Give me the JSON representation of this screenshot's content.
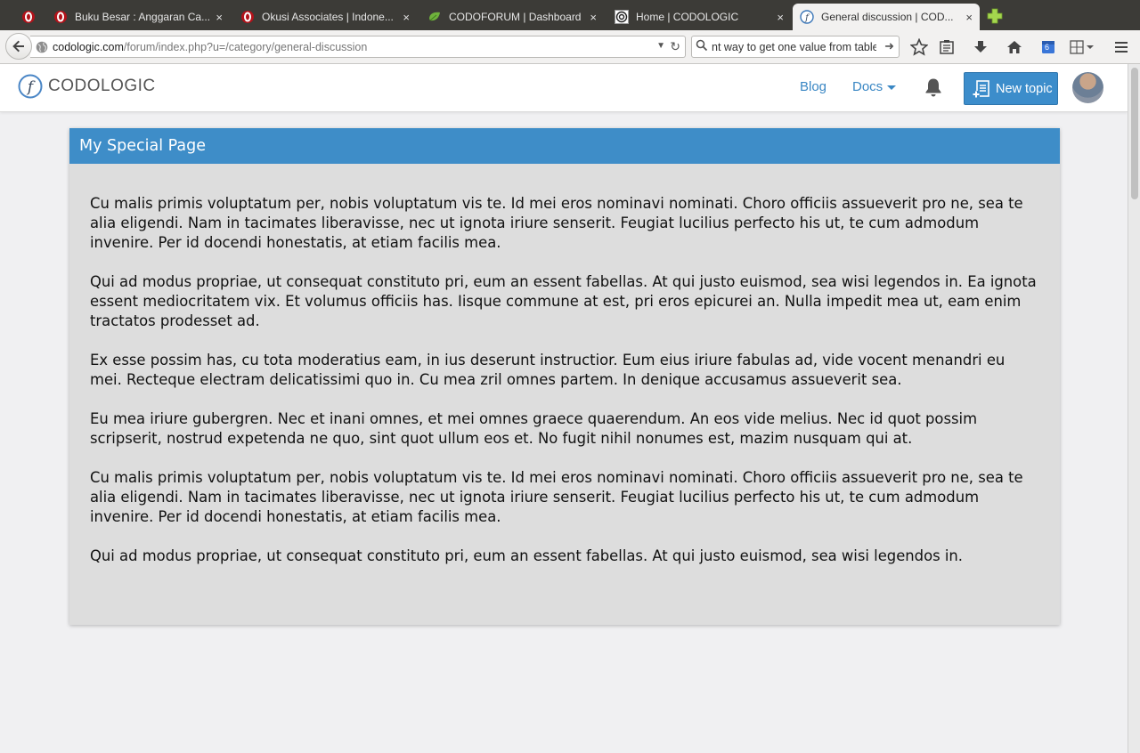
{
  "browser": {
    "tabs": [
      {
        "label": "",
        "pinned": true
      },
      {
        "label": "Buku Besar : Anggaran Ca..."
      },
      {
        "label": "Okusi Associates | Indone..."
      },
      {
        "label": "CODOFORUM | Dashboard"
      },
      {
        "label": "Home | CODOLOGIC"
      },
      {
        "label": "General discussion | COD...",
        "active": true
      }
    ],
    "close_glyph": "×",
    "url_host": "codologic.com",
    "url_path": "/forum/index.php?u=/category/general-discussion",
    "search_value": "nt way to get one value from table",
    "downloads_badge": "6",
    "colors": {
      "tabbar": "#3c3b37",
      "toolbar": "#f2f1f0"
    }
  },
  "site": {
    "logo_text": "CODOLOGIC",
    "nav": {
      "blog": "Blog",
      "docs": "Docs"
    },
    "new_topic_label": "New topic",
    "accent": "#3c8dcb"
  },
  "card": {
    "title": "My Special Page",
    "paragraphs": [
      "Cu malis primis voluptatum per, nobis voluptatum vis te. Id mei eros nominavi nominati. Choro officiis assueverit pro ne, sea te alia eligendi. Nam in tacimates liberavisse, nec ut ignota iriure senserit. Feugiat lucilius perfecto his ut, te cum admodum invenire. Per id docendi honestatis, at etiam facilis mea.",
      "Qui ad modus propriae, ut consequat constituto pri, eum an essent fabellas. At qui justo euismod, sea wisi legendos in. Ea ignota essent mediocritatem vix. Et volumus officiis has. Iisque commune at est, pri eros epicurei an. Nulla impedit mea ut, eam enim tractatos prodesset ad.",
      "Ex esse possim has, cu tota moderatius eam, in ius deserunt instructior. Eum eius iriure fabulas ad, vide vocent menandri eu mei. Recteque electram delicatissimi quo in. Cu mea zril omnes partem. In denique accusamus assueverit sea.",
      "Eu mea iriure gubergren. Nec et inani omnes, et mei omnes graece quaerendum. An eos vide melius. Nec id quot possim scripserit, nostrud expetenda ne quo, sint quot ullum eos et. No fugit nihil nonumes est, mazim nusquam qui at.",
      "Cu malis primis voluptatum per, nobis voluptatum vis te. Id mei eros nominavi nominati. Choro officiis assueverit pro ne, sea te alia eligendi. Nam in tacimates liberavisse, nec ut ignota iriure senserit. Feugiat lucilius perfecto his ut, te cum admodum invenire. Per id docendi honestatis, at etiam facilis mea.",
      "Qui ad modus propriae, ut consequat constituto pri, eum an essent fabellas. At qui justo euismod, sea wisi legendos in."
    ],
    "header_color": "#3e8dc8"
  }
}
